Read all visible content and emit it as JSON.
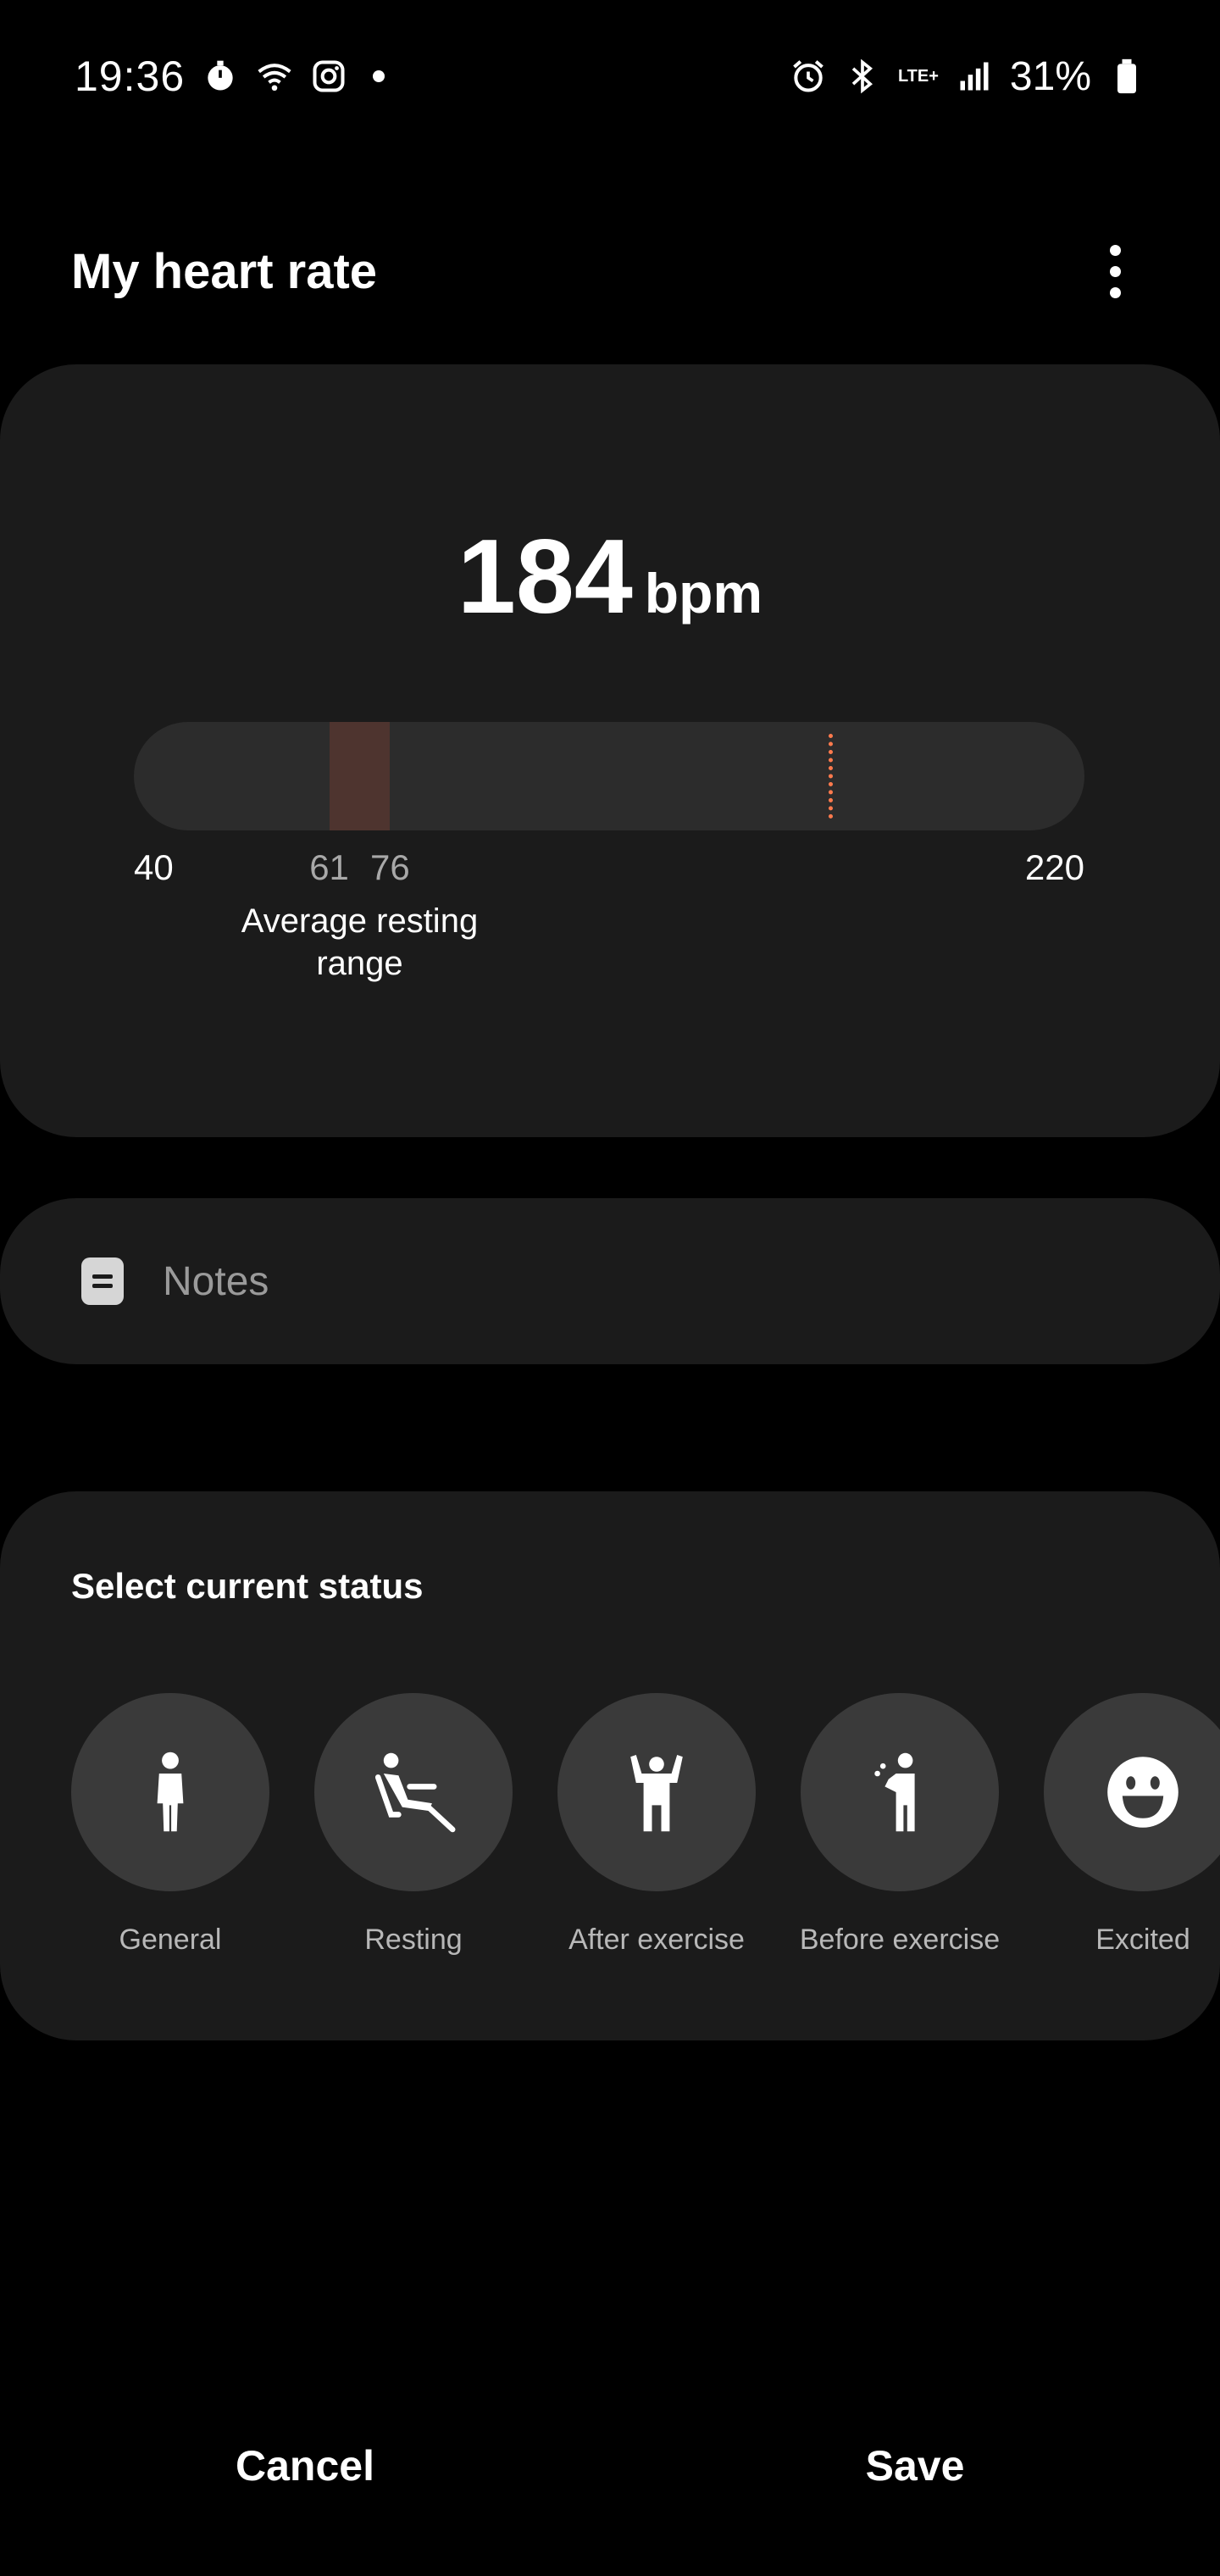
{
  "status_bar": {
    "time": "19:36",
    "battery": "31%",
    "network_label": "LTE+",
    "left_icons": [
      "stopwatch-icon",
      "wifi-icon",
      "instagram-icon",
      "notification-dot-icon"
    ],
    "right_icons": [
      "alarm-icon",
      "bluetooth-icon",
      "lte-icon",
      "signal-icon",
      "battery-icon"
    ]
  },
  "header": {
    "title": "My heart rate",
    "menu_icon": "more-vert-icon"
  },
  "heart_rate": {
    "value": "184",
    "unit": "bpm",
    "scale_min": "40",
    "scale_max": "220",
    "resting_low": "61",
    "resting_high": "76",
    "resting_label": "Average resting range",
    "marker_value": 184,
    "band_color": "#4e342f",
    "marker_color": "#ff7a4d"
  },
  "notes": {
    "placeholder": "Notes",
    "icon": "note-icon"
  },
  "status": {
    "heading": "Select current status",
    "items": [
      {
        "label": "General",
        "icon": "person-standing-icon"
      },
      {
        "label": "Resting",
        "icon": "person-reclining-icon"
      },
      {
        "label": "After exercise",
        "icon": "person-flexing-icon"
      },
      {
        "label": "Before exercise",
        "icon": "person-stretching-icon"
      },
      {
        "label": "Excited",
        "icon": "smiley-face-icon"
      }
    ]
  },
  "actions": {
    "cancel": "Cancel",
    "save": "Save"
  }
}
